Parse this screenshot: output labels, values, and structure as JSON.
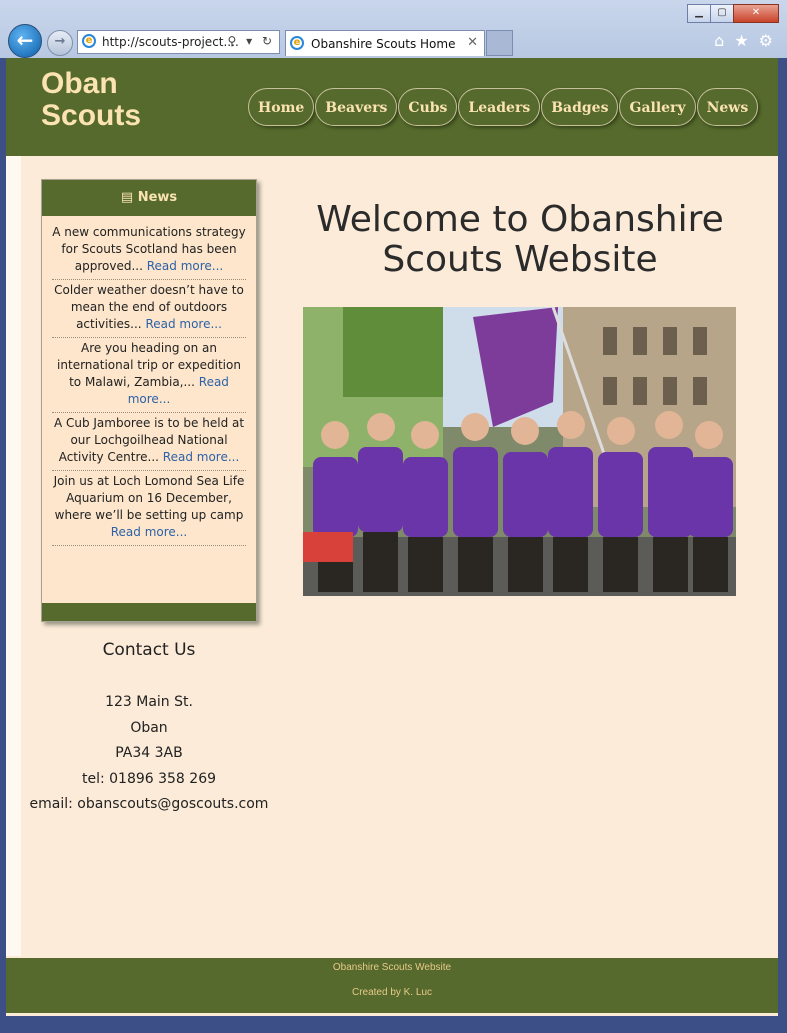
{
  "browser": {
    "url": "http://scouts-project....",
    "tab_title": "Obanshire Scouts Home",
    "tab_close": "✕",
    "addr_tools": "⚲ ▾ ↻",
    "minimize": "▁",
    "maximize": "▢",
    "close": "✕"
  },
  "site": {
    "logo": "Oban Scouts",
    "nav": [
      "Home",
      "Beavers",
      "Cubs",
      "Leaders",
      "Badges",
      "Gallery",
      "News"
    ]
  },
  "news": {
    "heading": "News",
    "items": [
      {
        "text": "A new communications strategy for Scouts Scotland has been approved...",
        "link": "Read more..."
      },
      {
        "text": "Colder weather doesn’t have to mean the end of outdoors activities...",
        "link": "Read more..."
      },
      {
        "text": "Are you heading on an international trip or expedition to Malawi, Zambia,...",
        "link": "Read more..."
      },
      {
        "text": "A Cub Jamboree is to be held at our Lochgoilhead National Activity Centre...",
        "link": "Read more..."
      },
      {
        "text": "Join us at Loch Lomond Sea Life Aquarium on 16 December, where we’ll be setting up camp",
        "link": "Read more..."
      }
    ]
  },
  "contact": {
    "heading": "Contact Us",
    "street": "123 Main St.",
    "town": "Oban",
    "postcode": "PA34 3AB",
    "tel": "tel: 01896 358 269",
    "email": "email: obanscouts@goscouts.com"
  },
  "main": {
    "welcome": "Welcome to Obanshire Scouts Website"
  },
  "footer": {
    "line1": "Obanshire Scouts Website",
    "line2": "Created by K. Luc"
  },
  "colors": {
    "brand_green": "#556a2c",
    "cream": "#fbebd8",
    "logo_text": "#fbe3b2",
    "link_blue": "#2d62a8"
  }
}
